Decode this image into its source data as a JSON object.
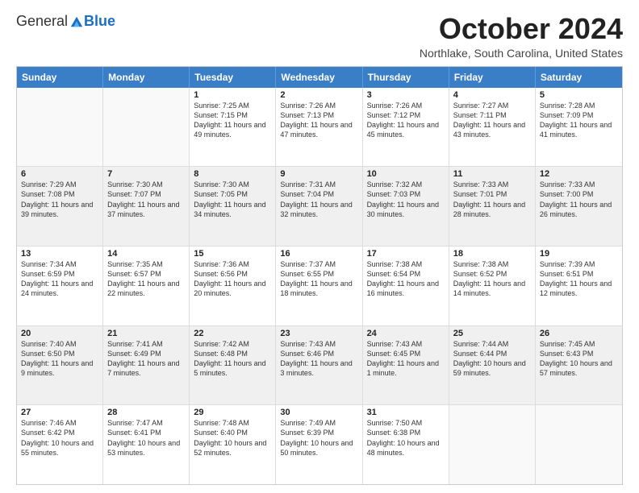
{
  "header": {
    "logo": {
      "general": "General",
      "blue": "Blue",
      "tagline": ""
    },
    "title": "October 2024",
    "location": "Northlake, South Carolina, United States"
  },
  "calendar": {
    "days": [
      "Sunday",
      "Monday",
      "Tuesday",
      "Wednesday",
      "Thursday",
      "Friday",
      "Saturday"
    ],
    "rows": [
      [
        {
          "day": "",
          "info": ""
        },
        {
          "day": "",
          "info": ""
        },
        {
          "day": "1",
          "info": "Sunrise: 7:25 AM\nSunset: 7:15 PM\nDaylight: 11 hours and 49 minutes."
        },
        {
          "day": "2",
          "info": "Sunrise: 7:26 AM\nSunset: 7:13 PM\nDaylight: 11 hours and 47 minutes."
        },
        {
          "day": "3",
          "info": "Sunrise: 7:26 AM\nSunset: 7:12 PM\nDaylight: 11 hours and 45 minutes."
        },
        {
          "day": "4",
          "info": "Sunrise: 7:27 AM\nSunset: 7:11 PM\nDaylight: 11 hours and 43 minutes."
        },
        {
          "day": "5",
          "info": "Sunrise: 7:28 AM\nSunset: 7:09 PM\nDaylight: 11 hours and 41 minutes."
        }
      ],
      [
        {
          "day": "6",
          "info": "Sunrise: 7:29 AM\nSunset: 7:08 PM\nDaylight: 11 hours and 39 minutes."
        },
        {
          "day": "7",
          "info": "Sunrise: 7:30 AM\nSunset: 7:07 PM\nDaylight: 11 hours and 37 minutes."
        },
        {
          "day": "8",
          "info": "Sunrise: 7:30 AM\nSunset: 7:05 PM\nDaylight: 11 hours and 34 minutes."
        },
        {
          "day": "9",
          "info": "Sunrise: 7:31 AM\nSunset: 7:04 PM\nDaylight: 11 hours and 32 minutes."
        },
        {
          "day": "10",
          "info": "Sunrise: 7:32 AM\nSunset: 7:03 PM\nDaylight: 11 hours and 30 minutes."
        },
        {
          "day": "11",
          "info": "Sunrise: 7:33 AM\nSunset: 7:01 PM\nDaylight: 11 hours and 28 minutes."
        },
        {
          "day": "12",
          "info": "Sunrise: 7:33 AM\nSunset: 7:00 PM\nDaylight: 11 hours and 26 minutes."
        }
      ],
      [
        {
          "day": "13",
          "info": "Sunrise: 7:34 AM\nSunset: 6:59 PM\nDaylight: 11 hours and 24 minutes."
        },
        {
          "day": "14",
          "info": "Sunrise: 7:35 AM\nSunset: 6:57 PM\nDaylight: 11 hours and 22 minutes."
        },
        {
          "day": "15",
          "info": "Sunrise: 7:36 AM\nSunset: 6:56 PM\nDaylight: 11 hours and 20 minutes."
        },
        {
          "day": "16",
          "info": "Sunrise: 7:37 AM\nSunset: 6:55 PM\nDaylight: 11 hours and 18 minutes."
        },
        {
          "day": "17",
          "info": "Sunrise: 7:38 AM\nSunset: 6:54 PM\nDaylight: 11 hours and 16 minutes."
        },
        {
          "day": "18",
          "info": "Sunrise: 7:38 AM\nSunset: 6:52 PM\nDaylight: 11 hours and 14 minutes."
        },
        {
          "day": "19",
          "info": "Sunrise: 7:39 AM\nSunset: 6:51 PM\nDaylight: 11 hours and 12 minutes."
        }
      ],
      [
        {
          "day": "20",
          "info": "Sunrise: 7:40 AM\nSunset: 6:50 PM\nDaylight: 11 hours and 9 minutes."
        },
        {
          "day": "21",
          "info": "Sunrise: 7:41 AM\nSunset: 6:49 PM\nDaylight: 11 hours and 7 minutes."
        },
        {
          "day": "22",
          "info": "Sunrise: 7:42 AM\nSunset: 6:48 PM\nDaylight: 11 hours and 5 minutes."
        },
        {
          "day": "23",
          "info": "Sunrise: 7:43 AM\nSunset: 6:46 PM\nDaylight: 11 hours and 3 minutes."
        },
        {
          "day": "24",
          "info": "Sunrise: 7:43 AM\nSunset: 6:45 PM\nDaylight: 11 hours and 1 minute."
        },
        {
          "day": "25",
          "info": "Sunrise: 7:44 AM\nSunset: 6:44 PM\nDaylight: 10 hours and 59 minutes."
        },
        {
          "day": "26",
          "info": "Sunrise: 7:45 AM\nSunset: 6:43 PM\nDaylight: 10 hours and 57 minutes."
        }
      ],
      [
        {
          "day": "27",
          "info": "Sunrise: 7:46 AM\nSunset: 6:42 PM\nDaylight: 10 hours and 55 minutes."
        },
        {
          "day": "28",
          "info": "Sunrise: 7:47 AM\nSunset: 6:41 PM\nDaylight: 10 hours and 53 minutes."
        },
        {
          "day": "29",
          "info": "Sunrise: 7:48 AM\nSunset: 6:40 PM\nDaylight: 10 hours and 52 minutes."
        },
        {
          "day": "30",
          "info": "Sunrise: 7:49 AM\nSunset: 6:39 PM\nDaylight: 10 hours and 50 minutes."
        },
        {
          "day": "31",
          "info": "Sunrise: 7:50 AM\nSunset: 6:38 PM\nDaylight: 10 hours and 48 minutes."
        },
        {
          "day": "",
          "info": ""
        },
        {
          "day": "",
          "info": ""
        }
      ]
    ]
  }
}
